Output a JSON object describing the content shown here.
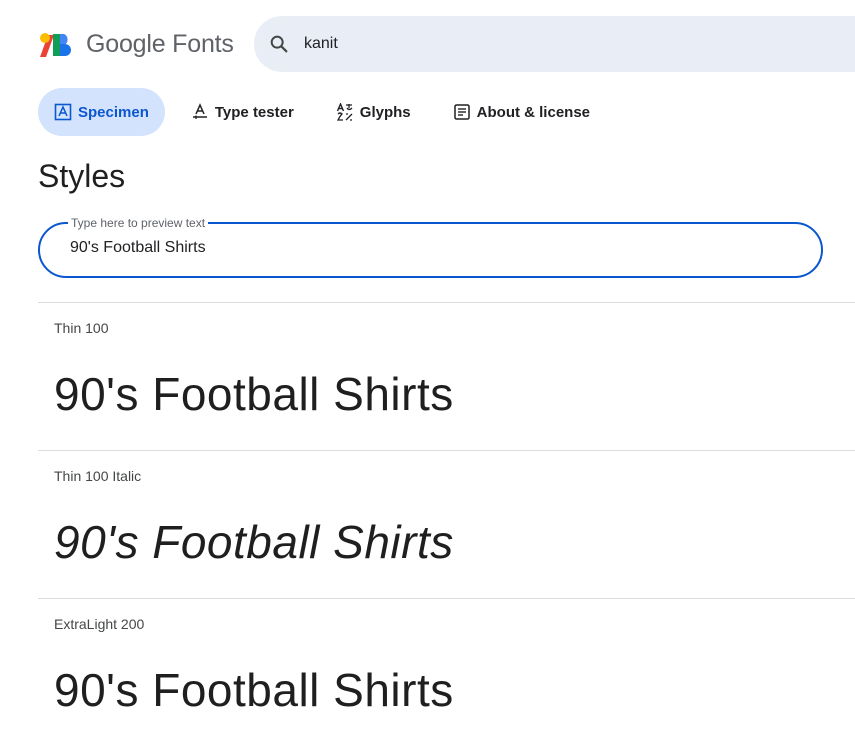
{
  "header": {
    "logo_google": "Google",
    "logo_fonts": "Fonts",
    "search_value": "kanit"
  },
  "tabs": [
    {
      "label": "Specimen",
      "icon": "specimen-icon",
      "active": true
    },
    {
      "label": "Type tester",
      "icon": "type-tester-icon",
      "active": false
    },
    {
      "label": "Glyphs",
      "icon": "glyphs-icon",
      "active": false
    },
    {
      "label": "About & license",
      "icon": "about-license-icon",
      "active": false
    }
  ],
  "styles": {
    "heading": "Styles",
    "preview_label": "Type here to preview text",
    "preview_value": "90's Football Shirts",
    "rows": [
      {
        "label": "Thin 100",
        "sample": "90's Football Shirts"
      },
      {
        "label": "Thin 100 Italic",
        "sample": "90's Football Shirts"
      },
      {
        "label": "ExtraLight 200",
        "sample": "90's Football Shirts"
      }
    ]
  },
  "colors": {
    "accent": "#0b57d0",
    "active_tab_bg": "#d3e3fd",
    "search_bg": "#e9eef6"
  }
}
